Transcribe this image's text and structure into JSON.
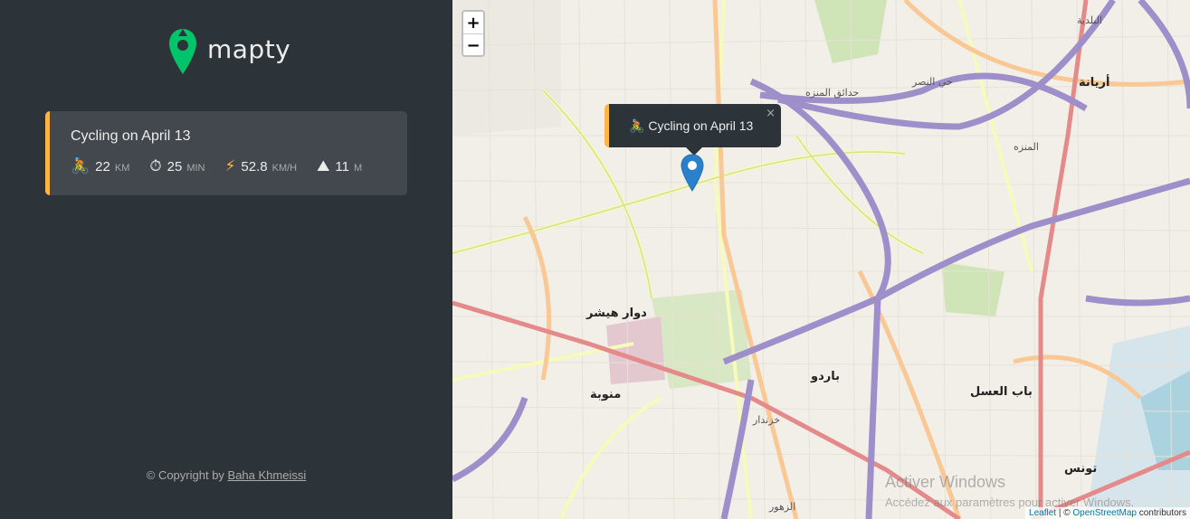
{
  "app": {
    "name": "mapty"
  },
  "workouts": [
    {
      "title": "Cycling on April 13",
      "type": "cycling",
      "accent_color": "#ffb545",
      "details": [
        {
          "icon": "🚴",
          "icon_name": "cyclist-icon",
          "value": "22",
          "unit": "km"
        },
        {
          "icon": "⏱",
          "icon_name": "stopwatch-icon",
          "value": "25",
          "unit": "min"
        },
        {
          "icon": "⚡",
          "icon_name": "lightning-icon",
          "value": "52.8",
          "unit": "km/h"
        },
        {
          "icon": "⛰",
          "icon_name": "mountain-icon",
          "value": "11",
          "unit": "m"
        }
      ]
    }
  ],
  "footer": {
    "copyright_prefix": "© Copyright by ",
    "author": "Baha Khmeissi"
  },
  "map": {
    "zoom_in": "+",
    "zoom_out": "−",
    "popup": {
      "icon": "🚴",
      "text": "Cycling on April 13",
      "close": "×"
    },
    "attribution": {
      "leaflet": "Leaflet",
      "separator": " | © ",
      "osm": "OpenStreetMap",
      "suffix": " contributors"
    },
    "labels": [
      {
        "text": "أريانة"
      },
      {
        "text": "دوار هيشر"
      },
      {
        "text": "منوبة"
      },
      {
        "text": "باردو"
      },
      {
        "text": "باب العسل"
      },
      {
        "text": "تونس"
      },
      {
        "text": "حدائق المنزه"
      },
      {
        "text": "المنزه"
      },
      {
        "text": "حي النصر"
      },
      {
        "text": "البلدية"
      },
      {
        "text": "خزندار"
      },
      {
        "text": "الزهور"
      }
    ]
  },
  "watermark": {
    "line1": "Activer Windows",
    "line2": "Accédez aux paramètres pour activer Windows."
  },
  "colors": {
    "sidebar_bg": "#2d3439",
    "card_bg": "#42484d",
    "cycling_accent": "#ffb545",
    "logo_green": "#00c46a",
    "marker_blue": "#2a81cb"
  }
}
